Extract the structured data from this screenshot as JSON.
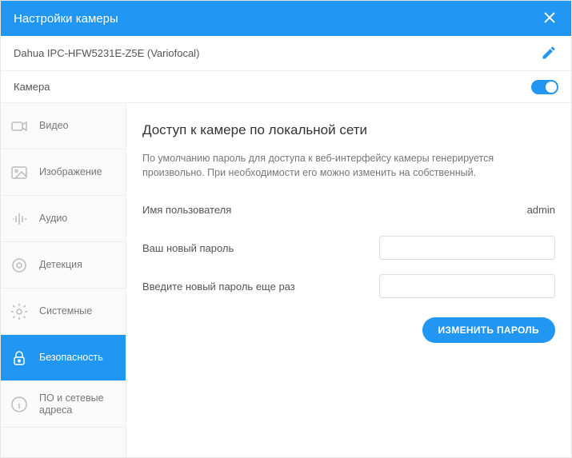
{
  "header": {
    "title": "Настройки камеры"
  },
  "camera": {
    "name": "Dahua IPC-HFW5231E-Z5E (Variofocal)",
    "enable_label": "Камера"
  },
  "sidebar": {
    "items": [
      {
        "label": "Видео"
      },
      {
        "label": "Изображение"
      },
      {
        "label": "Аудио"
      },
      {
        "label": "Детекция"
      },
      {
        "label": "Системные"
      },
      {
        "label": "Безопасность"
      },
      {
        "label": "ПО и сетевые адреса"
      }
    ]
  },
  "content": {
    "title": "Доступ к камере по локальной сети",
    "description": "По умолчанию пароль для доступа к веб-интерфейсу камеры генерируется произвольно. При необходимости его можно изменить на собственный.",
    "username_label": "Имя пользователя",
    "username_value": "admin",
    "password_label": "Ваш новый пароль",
    "password2_label": "Введите новый пароль еще раз",
    "submit_label": "ИЗМЕНИТЬ ПАРОЛЬ"
  }
}
